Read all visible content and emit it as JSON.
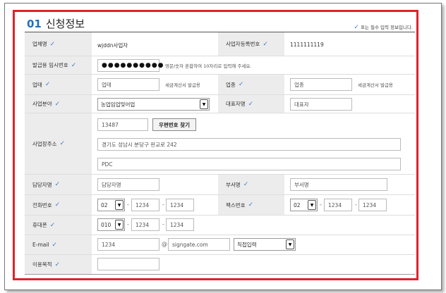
{
  "section": {
    "number": "01",
    "title": "신청정보",
    "required_note": "표는 필수 입력 정보입니다."
  },
  "labels": {
    "company": "업체명",
    "biz_no": "사업자등록번호",
    "temp_pw": "발급용 임시번호",
    "biz_type": "업태",
    "biz_item": "업종",
    "field": "사업분야",
    "ceo": "대표자명",
    "address": "사업장주소",
    "manager": "담당자명",
    "dept": "부서명",
    "phone": "전화번호",
    "fax": "팩스번호",
    "mobile": "휴대폰",
    "email": "E-mail",
    "purpose": "이용목적"
  },
  "values": {
    "company": "wjddn사업자",
    "biz_no": "1111111119",
    "temp_pw": "●●●●●●●●●●",
    "temp_pw_hint": "영문/숫자 혼합하여 10자리로 입력해 주세요.",
    "biz_type_placeholder": "업태",
    "biz_type_hint": "세금계산서 발급용",
    "biz_item_placeholder": "업종",
    "biz_item_hint": "세금계산서 발급용",
    "field_selected": "농업임업및어업",
    "ceo_placeholder": "대표자",
    "zipcode": "13487",
    "zip_button": "우편번호 찾기",
    "address1": "경기도 성남시 분당구 판교로 242",
    "address2": "PDC",
    "manager_placeholder": "담당자명",
    "dept_placeholder": "부서명",
    "phone_prefix": "02",
    "phone_mid": "1234",
    "phone_last": "1234",
    "fax_prefix": "02",
    "fax_mid": "1234",
    "fax_last": "1234",
    "mobile_prefix": "010",
    "mobile_mid": "1234",
    "mobile_last": "1234",
    "email_id": "1234",
    "email_at": "@",
    "email_domain": "signgate.com",
    "email_select": "직접입력",
    "purpose": "",
    "dash": "-"
  },
  "icons": {
    "check": "✓",
    "arrow": "▼"
  },
  "colors": {
    "accent": "#1f6fc0",
    "frame": "#e0222a",
    "check": "#3a7bd5"
  }
}
